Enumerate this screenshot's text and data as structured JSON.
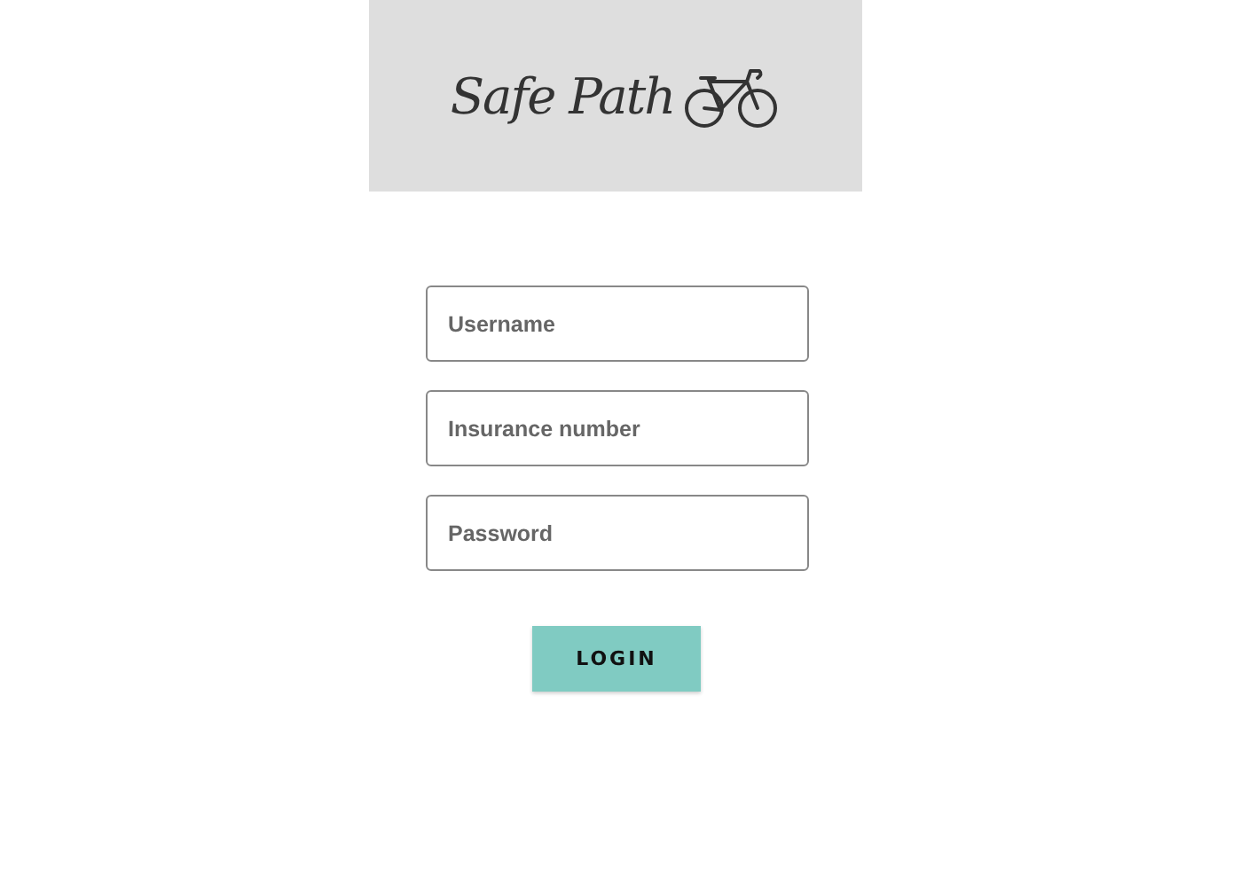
{
  "header": {
    "logo_text": "Safe Path"
  },
  "fields": [
    {
      "placeholder": "Username"
    },
    {
      "placeholder": "Insurance number"
    },
    {
      "placeholder": "Password"
    }
  ],
  "login_button": {
    "label": "LOGIN"
  }
}
